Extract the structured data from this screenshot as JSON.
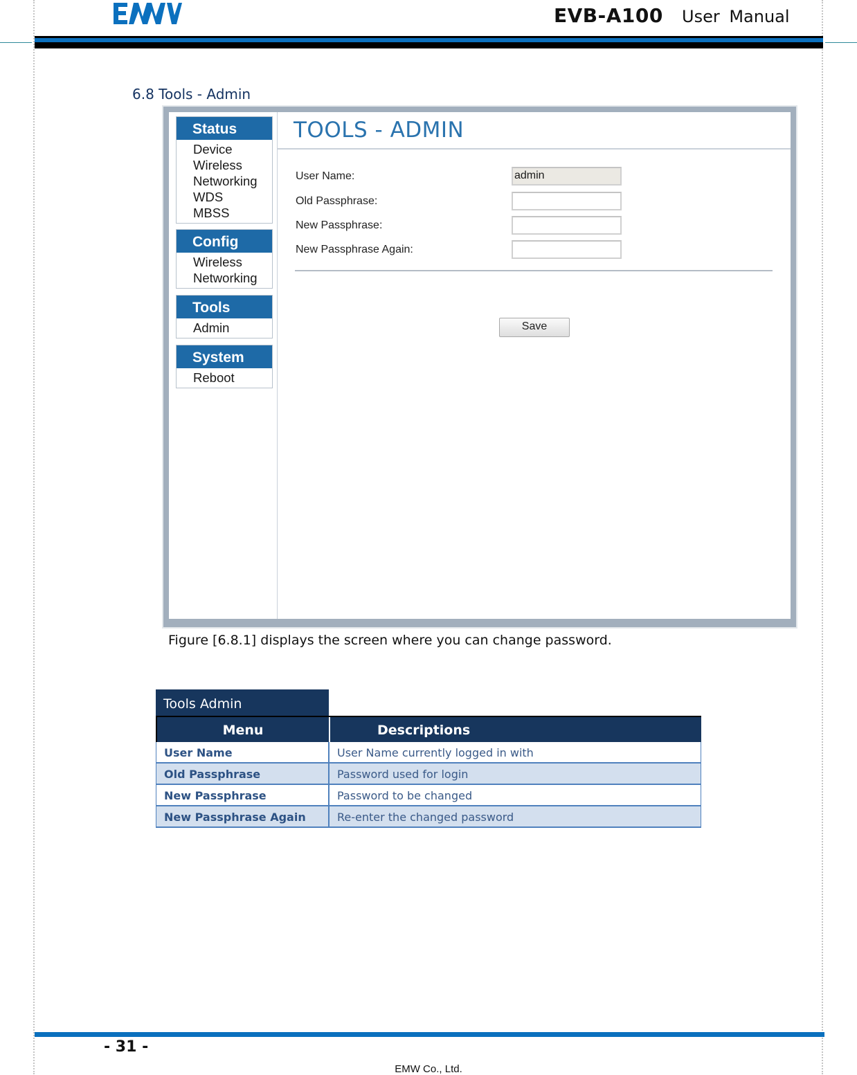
{
  "header": {
    "logo_text": "EMW",
    "product": "EVB-A100",
    "doc_type": "User  Manual",
    "brand_color": "#0b70be"
  },
  "section": {
    "title": "6.8 Tools - Admin"
  },
  "screenshot": {
    "nav": [
      {
        "heading": "Status",
        "items": [
          "Device",
          "Wireless",
          "Networking",
          "WDS",
          "MBSS"
        ]
      },
      {
        "heading": "Config",
        "items": [
          "Wireless",
          "Networking"
        ]
      },
      {
        "heading": "Tools",
        "items": [
          "Admin"
        ]
      },
      {
        "heading": "System",
        "items": [
          "Reboot"
        ]
      }
    ],
    "page_title": "TOOLS - ADMIN",
    "form": {
      "fields": [
        {
          "label": "User Name:",
          "value": "admin",
          "readonly": true
        },
        {
          "label": "Old Passphrase:",
          "value": "",
          "readonly": false
        },
        {
          "label": "New Passphrase:",
          "value": "",
          "readonly": false
        },
        {
          "label": "New Passphrase Again:",
          "value": "",
          "readonly": false
        }
      ],
      "save_label": "Save"
    },
    "accent_color": "#1e6aa7"
  },
  "caption": "Figure [6.8.1] displays the screen where you can change password.",
  "table": {
    "title": "Tools Admin",
    "headers": {
      "menu": "Menu",
      "desc": "Descriptions"
    },
    "rows": [
      {
        "menu": "User Name",
        "desc": "User Name currently logged in with"
      },
      {
        "menu": "Old Passphrase",
        "desc": "Password used for login"
      },
      {
        "menu": "New Passphrase",
        "desc": "Password to be changed"
      },
      {
        "menu": "New Passphrase Again",
        "desc": "Re-enter the changed password"
      }
    ],
    "header_color": "#17365d",
    "alt_row_color": "#d3dfee"
  },
  "footer": {
    "page_number": "- 31 -",
    "company": "EMW Co., Ltd."
  }
}
